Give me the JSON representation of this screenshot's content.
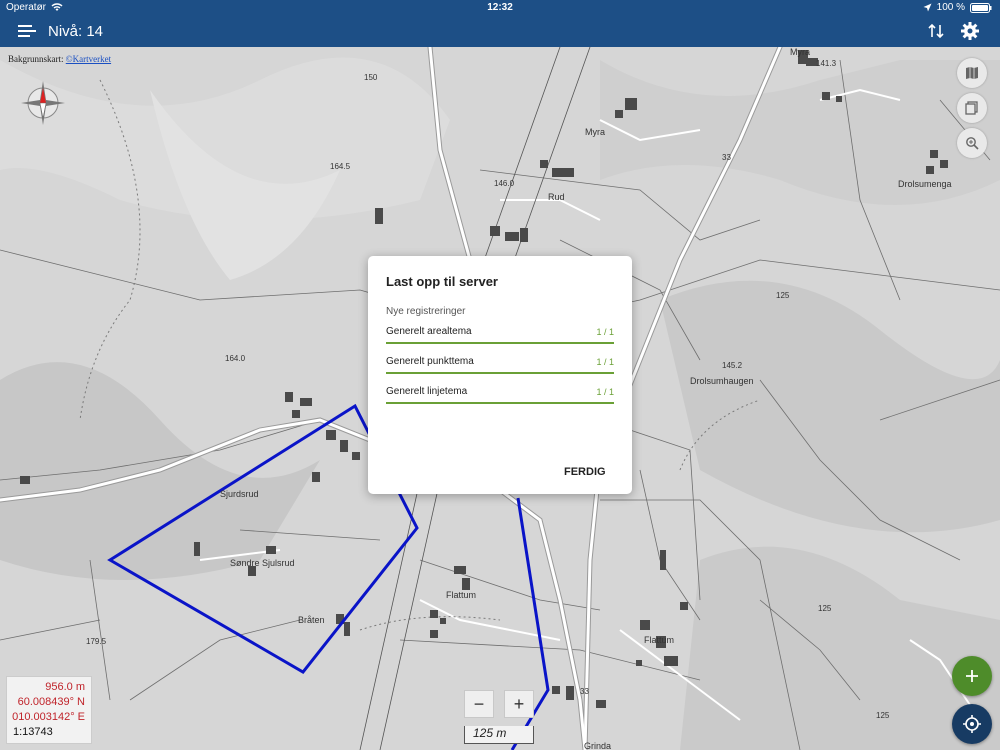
{
  "status": {
    "carrier": "Operatør",
    "time": "12:32",
    "battery": "100 %"
  },
  "appbar": {
    "title": "Nivå: 14"
  },
  "attribution": {
    "prefix": "Bakgrunnskart: ",
    "link": "©Kartverket"
  },
  "map_labels": {
    "myra": "Myra",
    "myra_top": "Myra",
    "rud": "Rud",
    "drolsumenga": "Drolsumenga",
    "drolsumhaugen": "Drolsumhaugen",
    "sjurdsrud": "Sjurdsrud",
    "sondre": "Søndre Sjulsrud",
    "braten": "Bråten",
    "flattum1": "Flattum",
    "flattum2": "Flattum",
    "grinda": "Grinda",
    "h1645": "164.5",
    "h1640": "164.0",
    "h1460": "146.0",
    "h1413": "141.3",
    "h1452": "145.2",
    "h1795": "179.5",
    "c125a": "125",
    "c125b": "125",
    "c125c": "125",
    "c150": "150",
    "rd33": "33",
    "rd33b": "33"
  },
  "dialog": {
    "title": "Last opp til server",
    "subtitle": "Nye registreringer",
    "rows": [
      {
        "label": "Generelt arealtema",
        "count": "1 / 1"
      },
      {
        "label": "Generelt punkttema",
        "count": "1 / 1"
      },
      {
        "label": "Generelt linjetema",
        "count": "1 / 1"
      }
    ],
    "done_label": "FERDIG"
  },
  "info": {
    "altitude": "956.0  m",
    "lat": "60.008439° N",
    "lon": "010.003142° E",
    "scale": "1:13743"
  },
  "zoom": {
    "minus": "−",
    "plus": "+"
  },
  "scalebar": {
    "label": "125 m"
  },
  "colors": {
    "appbar": "#1d4f86",
    "accent_green": "#6aa036",
    "polygon_blue": "#0a14c8",
    "fab_green": "#4e8c2a",
    "fab_navy": "#173b63"
  }
}
